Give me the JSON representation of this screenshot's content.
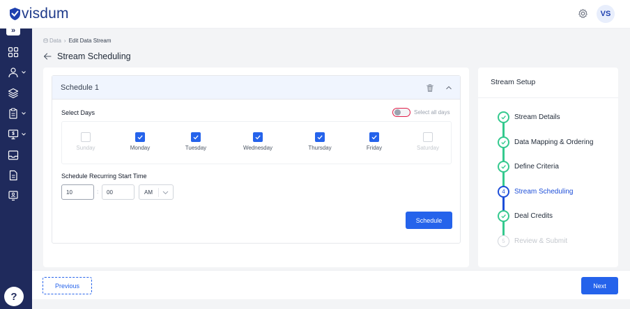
{
  "app": {
    "logo_text": "visdum",
    "user_initials": "VS"
  },
  "header": {
    "settings_icon": "gear-icon"
  },
  "rail": {
    "toggle_label": "»",
    "help_label": "?"
  },
  "breadcrumb": {
    "root": "Data",
    "current": "Edit Data Stream"
  },
  "page": {
    "title": "Stream Scheduling"
  },
  "schedule": {
    "title": "Schedule 1",
    "select_days_label": "Select Days",
    "select_all_label": "Select all days",
    "select_all_enabled": false,
    "days": [
      {
        "label": "Sunday",
        "checked": false
      },
      {
        "label": "Monday",
        "checked": true
      },
      {
        "label": "Tuesday",
        "checked": true
      },
      {
        "label": "Wednesday",
        "checked": true
      },
      {
        "label": "Thursday",
        "checked": true
      },
      {
        "label": "Friday",
        "checked": true
      },
      {
        "label": "Saturday",
        "checked": false
      }
    ],
    "time_label": "Schedule Recurring Start Time",
    "hour": "10",
    "separator": ":",
    "minute": "00",
    "ampm": "AM",
    "schedule_button": "Schedule"
  },
  "setup": {
    "title": "Stream Setup",
    "steps": [
      {
        "label": "Stream Details",
        "state": "done",
        "number": ""
      },
      {
        "label": "Data Mapping & Ordering",
        "state": "done",
        "number": ""
      },
      {
        "label": "Define Criteria",
        "state": "done",
        "number": ""
      },
      {
        "label": "Stream Scheduling",
        "state": "current",
        "number": "4"
      },
      {
        "label": "Deal Credits",
        "state": "done",
        "number": ""
      },
      {
        "label": "Review & Submit",
        "state": "todo",
        "number": "5"
      }
    ]
  },
  "footer": {
    "previous_label": "Previous",
    "next_label": "Next"
  },
  "colors": {
    "primary": "#2563eb",
    "rail": "#1f2a5c",
    "done": "#34c98e",
    "toggle_border": "#e11d48"
  }
}
